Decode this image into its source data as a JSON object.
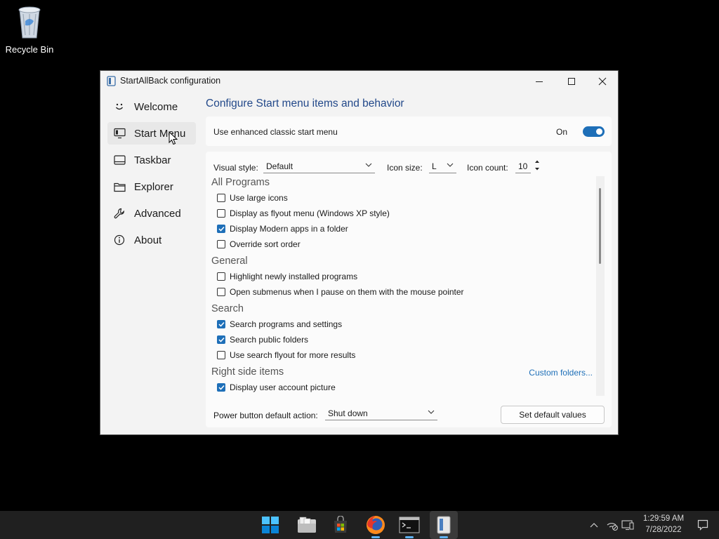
{
  "desktop": {
    "recycle_bin_label": "Recycle Bin"
  },
  "window": {
    "title": "StartAllBack configuration",
    "nav": [
      {
        "id": "welcome",
        "label": "Welcome",
        "icon": "smiley-icon"
      },
      {
        "id": "start-menu",
        "label": "Start Menu",
        "icon": "start-menu-icon",
        "active": true
      },
      {
        "id": "taskbar",
        "label": "Taskbar",
        "icon": "taskbar-icon"
      },
      {
        "id": "explorer",
        "label": "Explorer",
        "icon": "folder-icon"
      },
      {
        "id": "advanced",
        "label": "Advanced",
        "icon": "wrench-icon"
      },
      {
        "id": "about",
        "label": "About",
        "icon": "info-icon"
      }
    ],
    "heading": "Configure Start menu items and behavior",
    "enhanced": {
      "label": "Use enhanced classic start menu",
      "state_label": "On",
      "on": true
    },
    "controls": {
      "visual_style_label": "Visual style:",
      "visual_style_value": "Default",
      "icon_size_label": "Icon size:",
      "icon_size_value": "L",
      "icon_count_label": "Icon count:",
      "icon_count_value": "10"
    },
    "sections": [
      {
        "title": "All Programs",
        "options": [
          {
            "label": "Use large icons",
            "checked": false
          },
          {
            "label": "Display as flyout menu (Windows XP style)",
            "checked": false
          },
          {
            "label": "Display Modern apps in a folder",
            "checked": true
          },
          {
            "label": "Override sort order",
            "checked": false
          }
        ]
      },
      {
        "title": "General",
        "options": [
          {
            "label": "Highlight newly installed programs",
            "checked": false
          },
          {
            "label": "Open submenus when I pause on them with the mouse pointer",
            "checked": false
          }
        ]
      },
      {
        "title": "Search",
        "options": [
          {
            "label": "Search programs and settings",
            "checked": true
          },
          {
            "label": "Search public folders",
            "checked": true
          },
          {
            "label": "Use search flyout for more results",
            "checked": false
          }
        ]
      },
      {
        "title": "Right side items",
        "link": "Custom folders...",
        "options": [
          {
            "label": "Display user account picture",
            "checked": true
          }
        ]
      }
    ],
    "power": {
      "label": "Power button default action:",
      "value": "Shut down"
    },
    "set_default_label": "Set default values"
  },
  "taskbar": {
    "apps": [
      "start-icon",
      "file-explorer-icon",
      "store-icon",
      "firefox-icon",
      "terminal-icon",
      "startallback-icon"
    ],
    "clock_time": "1:29:59 AM",
    "clock_date": "7/28/2022"
  },
  "colors": {
    "accent": "#1e6fb8",
    "heading": "#23498a",
    "taskbar": "#202020"
  }
}
